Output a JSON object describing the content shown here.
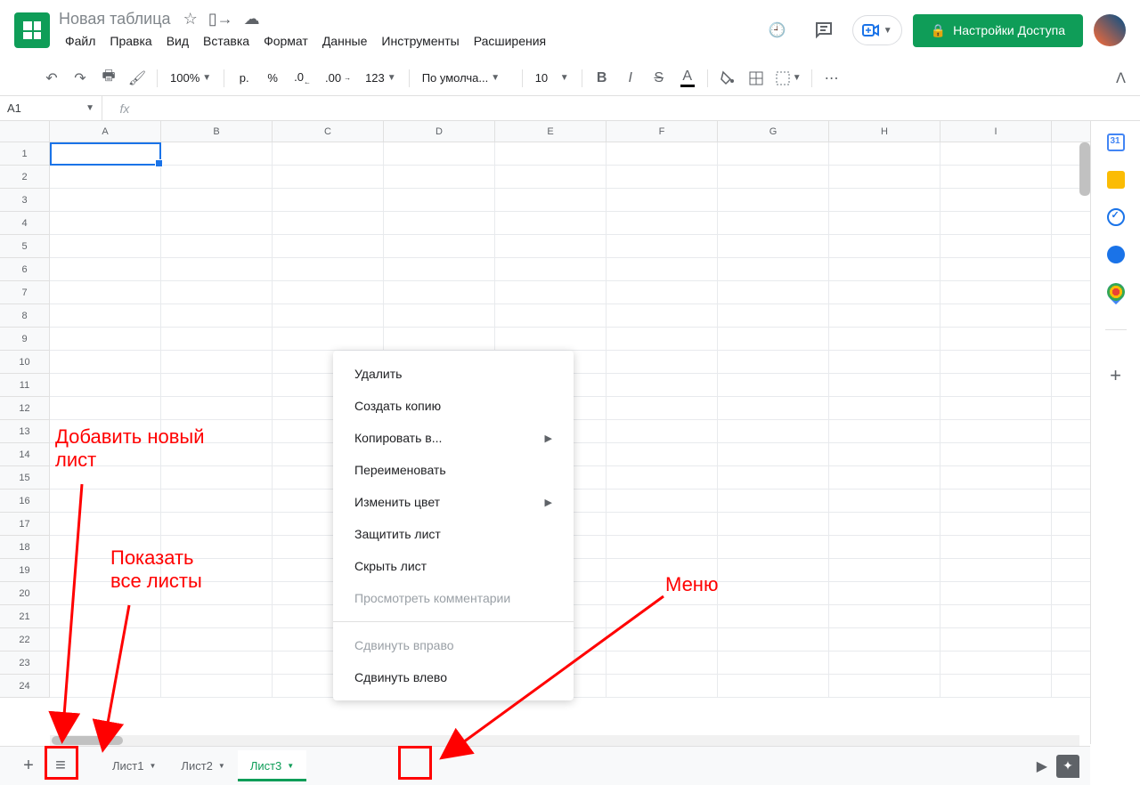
{
  "doc": {
    "title": "Новая таблица"
  },
  "menus": [
    "Файл",
    "Правка",
    "Вид",
    "Вставка",
    "Формат",
    "Данные",
    "Инструменты",
    "Расширения"
  ],
  "share": "Настройки Доступа",
  "toolbar": {
    "zoom": "100%",
    "currency": "р.",
    "percent": "%",
    "dec_dec": ",0",
    "dec_inc": ",00",
    "format123": "123",
    "font": "По умолча...",
    "font_size": "10"
  },
  "name_box": "A1",
  "fx": "fx",
  "columns": [
    "A",
    "B",
    "C",
    "D",
    "E",
    "F",
    "G",
    "H",
    "I"
  ],
  "rows": [
    "1",
    "2",
    "3",
    "4",
    "5",
    "6",
    "7",
    "8",
    "9",
    "10",
    "11",
    "12",
    "13",
    "14",
    "15",
    "16",
    "17",
    "18",
    "19",
    "20",
    "21",
    "22",
    "23",
    "24"
  ],
  "sheets": {
    "add": "+",
    "all": "≡",
    "tabs": [
      {
        "label": "Лист1",
        "active": false
      },
      {
        "label": "Лист2",
        "active": false
      },
      {
        "label": "Лист3",
        "active": true
      }
    ]
  },
  "ctx": {
    "items": [
      {
        "label": "Удалить",
        "sub": false,
        "disabled": false
      },
      {
        "label": "Создать копию",
        "sub": false,
        "disabled": false
      },
      {
        "label": "Копировать в...",
        "sub": true,
        "disabled": false
      },
      {
        "label": "Переименовать",
        "sub": false,
        "disabled": false
      },
      {
        "label": "Изменить цвет",
        "sub": true,
        "disabled": false
      },
      {
        "label": "Защитить лист",
        "sub": false,
        "disabled": false
      },
      {
        "label": "Скрыть лист",
        "sub": false,
        "disabled": false
      },
      {
        "label": "Просмотреть комментарии",
        "sub": false,
        "disabled": true
      }
    ],
    "moves": [
      {
        "label": "Сдвинуть вправо",
        "disabled": true
      },
      {
        "label": "Сдвинуть влево",
        "disabled": false
      }
    ]
  },
  "side_panel": {
    "calendar_day": "31"
  },
  "annotations": {
    "add_sheet": "Добавить новый лист",
    "show_all": "Показать все листы",
    "menu": "Меню"
  }
}
